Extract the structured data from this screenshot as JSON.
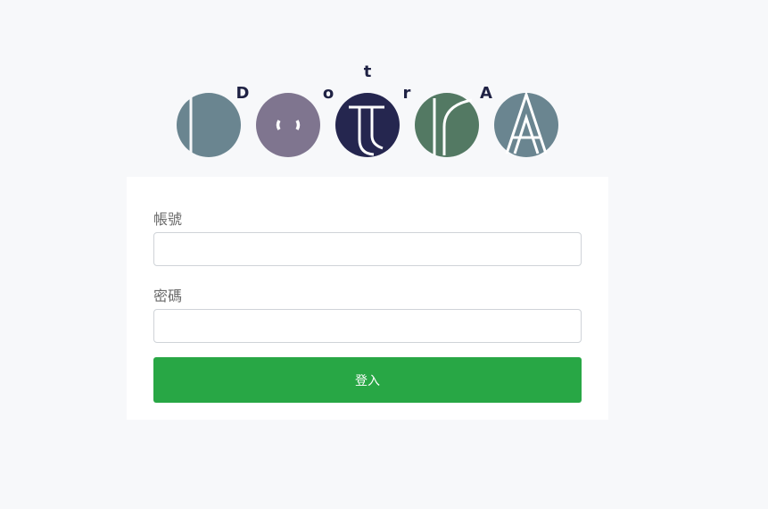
{
  "logo": {
    "letters": [
      "D",
      "o",
      "t",
      "r",
      "A"
    ],
    "colors": {
      "circle1": "#6a8590",
      "circle2": "#7f758f",
      "circle3": "#25264f",
      "circle4": "#537963",
      "circle5": "#6a8590",
      "letters": "#1f2244"
    }
  },
  "form": {
    "account_label": "帳號",
    "account_value": "",
    "account_placeholder": "",
    "password_label": "密碼",
    "password_value": "",
    "password_placeholder": "",
    "submit_label": "登入",
    "submit_color": "#28a745"
  }
}
